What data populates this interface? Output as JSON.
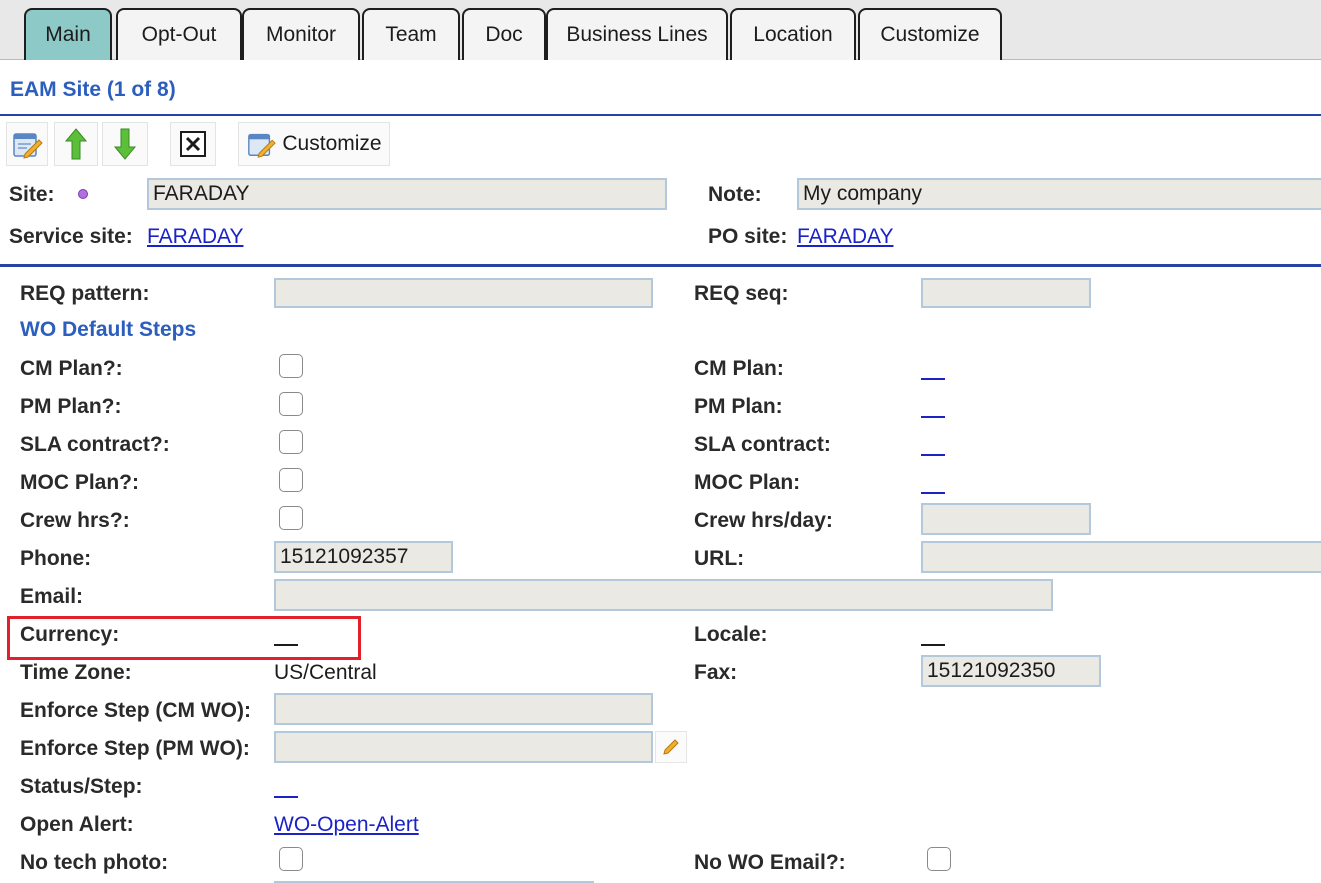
{
  "tabs": [
    {
      "label": "Main",
      "active": true
    },
    {
      "label": "Opt-Out"
    },
    {
      "label": "Monitor"
    },
    {
      "label": "Team"
    },
    {
      "label": "Doc"
    },
    {
      "label": "Business Lines"
    },
    {
      "label": "Location"
    },
    {
      "label": "Customize"
    }
  ],
  "header": {
    "title": "EAM Site (1 of 8)"
  },
  "toolbar": {
    "edit_icon": "edit-pencil-icon",
    "up_icon": "arrow-up-icon",
    "down_icon": "arrow-down-icon",
    "delete_icon": "close-box-icon",
    "customize_label": "Customize"
  },
  "site": {
    "site_label": "Site:",
    "site_value": "FARADAY",
    "note_label": "Note:",
    "note_value": "My company",
    "service_site_label": "Service site:",
    "service_site_value": "FARADAY",
    "po_site_label": "PO site:",
    "po_site_value": "FARADAY"
  },
  "form": {
    "req_pattern_label": "REQ pattern:",
    "req_pattern_value": "",
    "req_seq_label": "REQ seq:",
    "req_seq_value": "",
    "wo_default_steps": "WO Default Steps",
    "cm_plan_q_label": "CM Plan?:",
    "cm_plan_label": "CM Plan:",
    "pm_plan_q_label": "PM Plan?:",
    "pm_plan_label": "PM Plan:",
    "sla_q_label": "SLA contract?:",
    "sla_label": "SLA contract:",
    "moc_q_label": "MOC Plan?:",
    "moc_label": "MOC Plan:",
    "crew_q_label": "Crew hrs?:",
    "crew_day_label": "Crew hrs/day:",
    "crew_day_value": "",
    "phone_label": "Phone:",
    "phone_value": "15121092357",
    "url_label": "URL:",
    "url_value": "",
    "email_label": "Email:",
    "email_value": "",
    "currency_label": "Currency:",
    "locale_label": "Locale:",
    "timezone_label": "Time Zone:",
    "timezone_value": "US/Central",
    "fax_label": "Fax:",
    "fax_value": "15121092350",
    "enforce_cm_label": "Enforce Step (CM WO):",
    "enforce_cm_value": "",
    "enforce_pm_label": "Enforce Step (PM WO):",
    "enforce_pm_value": "",
    "status_step_label": "Status/Step:",
    "open_alert_label": "Open Alert:",
    "open_alert_value": "WO-Open-Alert",
    "no_tech_photo_label": "No tech photo:",
    "no_wo_email_label": "No WO Email?:"
  },
  "colors": {
    "active_tab": "#8dc9c7",
    "title_blue": "#2b5ebd",
    "link_blue": "#1a22c8",
    "highlight_red": "#e0202a"
  }
}
